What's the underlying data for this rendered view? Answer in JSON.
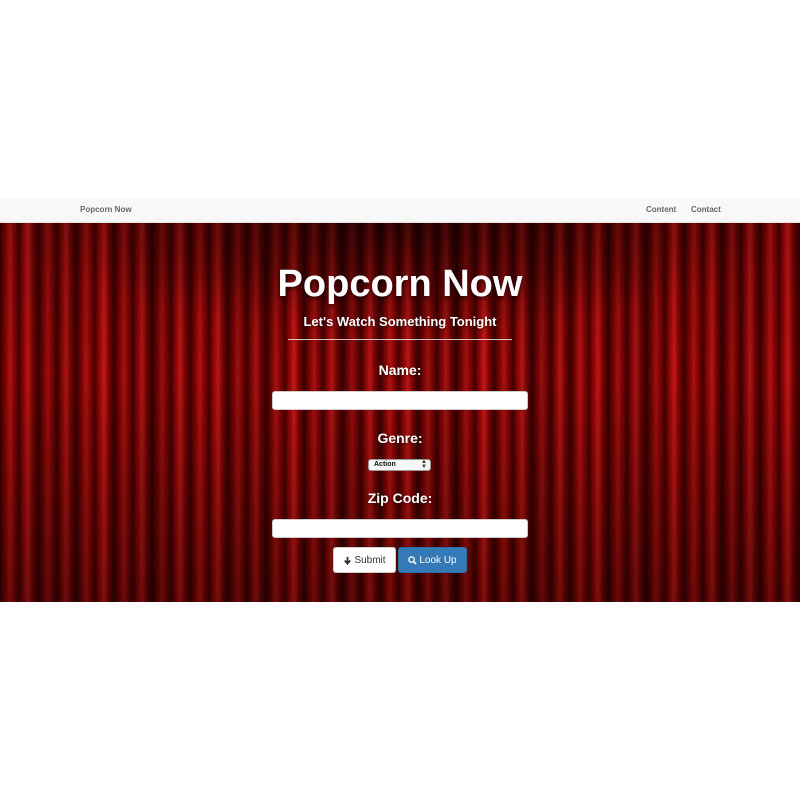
{
  "navbar": {
    "brand": "Popcorn Now",
    "links": [
      {
        "label": "Content"
      },
      {
        "label": "Contact"
      }
    ]
  },
  "hero": {
    "title": "Popcorn Now",
    "subtitle": "Let's Watch Something Tonight"
  },
  "form": {
    "name_label": "Name:",
    "name_value": "",
    "genre_label": "Genre:",
    "genre_selected": "Action",
    "zip_label": "Zip Code:",
    "zip_value": "",
    "submit_label": "Submit",
    "lookup_label": "Look Up"
  },
  "icons": {
    "submit": "arrow-down-icon",
    "lookup": "search-icon",
    "select": "select-arrows-icon"
  },
  "colors": {
    "curtain": "#8a0505",
    "lookup_button": "#337ab7",
    "navbar_bg": "#f8f8f8"
  }
}
